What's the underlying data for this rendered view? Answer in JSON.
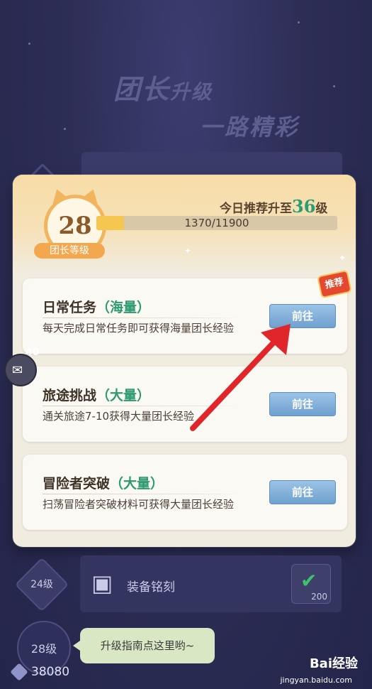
{
  "header": {
    "title_main": "团长",
    "title_tail": "升级",
    "subtitle": "一路精彩"
  },
  "level": {
    "number": "28",
    "label": "团长等级"
  },
  "recommend": {
    "prefix": "今日推荐升至",
    "target": "36",
    "suffix": "级"
  },
  "exp": {
    "text": "1370/11900",
    "progress": 0.115
  },
  "cards": [
    {
      "title": "日常任务",
      "tag": "（海量）",
      "desc": "每天完成日常任务即可获得海量团长经验",
      "button": "前往",
      "badge": "推荐"
    },
    {
      "title": "旅途挑战",
      "tag": "（大量）",
      "desc": "通关旅途7-10获得大量团长经验",
      "button": "前往"
    },
    {
      "title": "冒险者突破",
      "tag": "（大量）",
      "desc": "扫荡冒险者突破材料可获得大量团长经验",
      "button": "前往"
    }
  ],
  "side": {
    "count": "40"
  },
  "bottom": {
    "node_24": "24级",
    "row_name": "装备铭刻",
    "reward_count": "200",
    "node_28": "28级",
    "guide": "升级指南点这里哟~",
    "gems": "38080"
  },
  "watermark": {
    "brand": "Bai经验",
    "url": "jingyan.baidu.com"
  },
  "colors": {
    "accent_green": "#2e9a72",
    "button_blue": "#6fa0cf",
    "arrow_red": "#e0262b"
  }
}
